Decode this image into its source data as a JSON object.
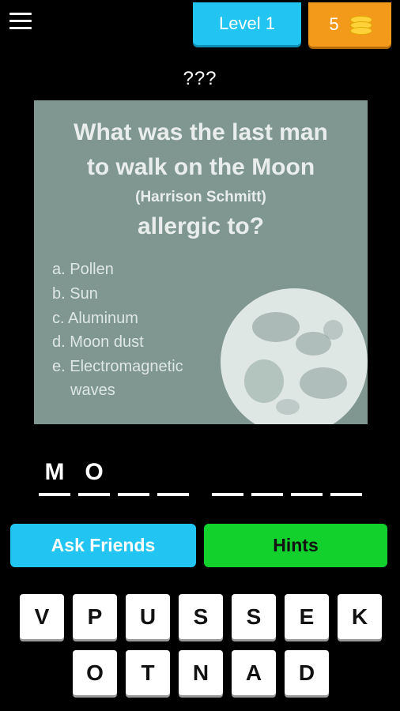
{
  "header": {
    "menu_icon": "hamburger-icon",
    "level_label": "Level 1",
    "coins": "5",
    "coin_icon": "coin-stack-icon"
  },
  "title": "???",
  "question": {
    "line1": "What was the last man",
    "line2": "to walk on the Moon",
    "line3": "(Harrison Schmitt)",
    "line4": "allergic to?",
    "options": [
      "a. Pollen",
      "b. Sun",
      "c. Aluminum",
      "d. Moon dust",
      "e. Electromagnetic",
      "waves"
    ],
    "image": "moon-illustration"
  },
  "answer": {
    "slots": [
      "M",
      "O",
      "",
      "",
      "",
      "",
      "",
      ""
    ]
  },
  "buttons": {
    "ask": "Ask Friends",
    "hints": "Hints"
  },
  "keyboard": {
    "row1": [
      "V",
      "P",
      "U",
      "S",
      "S",
      "E",
      "K"
    ],
    "row2": [
      "O",
      "T",
      "N",
      "A",
      "D"
    ]
  },
  "colors": {
    "level_bg": "#22c4f2",
    "coins_bg": "#f39a1b",
    "card_bg": "#7f9691",
    "hints_bg": "#12d12c"
  }
}
